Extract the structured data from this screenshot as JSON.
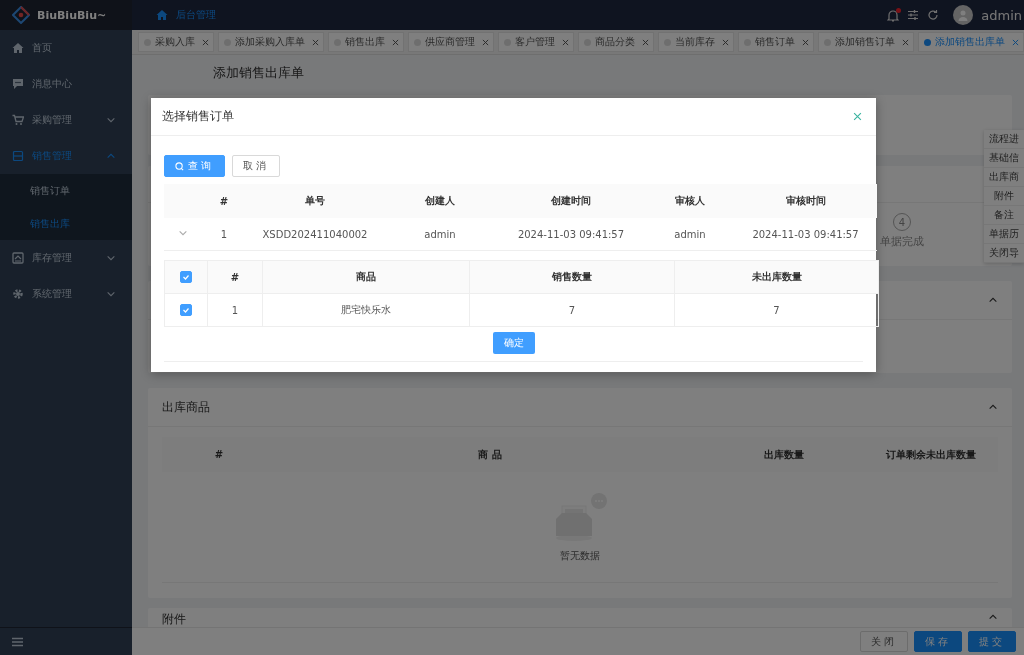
{
  "app": {
    "logo": "BiuBiuBiu~"
  },
  "sidebar": {
    "items": [
      {
        "kind": "link",
        "label": "首页",
        "selected": false
      },
      {
        "kind": "link",
        "label": "消息中心",
        "selected": false
      },
      {
        "kind": "group",
        "label": "采购管理",
        "selected": false,
        "expanded": false
      },
      {
        "kind": "group",
        "label": "销售管理",
        "selected": true,
        "expanded": true,
        "children": [
          {
            "label": "销售订单",
            "selected": false
          },
          {
            "label": "销售出库",
            "selected": true
          }
        ]
      },
      {
        "kind": "group",
        "label": "库存管理",
        "selected": false,
        "expanded": false
      },
      {
        "kind": "group",
        "label": "系统管理",
        "selected": false,
        "expanded": false
      }
    ]
  },
  "header": {
    "breadcrumb": "后台管理",
    "notification": true,
    "user": "admin"
  },
  "tabs": [
    {
      "label": "采购入库",
      "selected": false
    },
    {
      "label": "添加采购入库单",
      "selected": false
    },
    {
      "label": "销售出库",
      "selected": false
    },
    {
      "label": "供应商管理",
      "selected": false
    },
    {
      "label": "客户管理",
      "selected": false
    },
    {
      "label": "商品分类",
      "selected": false
    },
    {
      "label": "当前库存",
      "selected": false
    },
    {
      "label": "销售订单",
      "selected": false
    },
    {
      "label": "添加销售订单",
      "selected": false
    },
    {
      "label": "添加销售出库单",
      "selected": true
    }
  ],
  "page": {
    "title": "添加销售出库单"
  },
  "steps": [
    {
      "number": "4",
      "label": "单据完成"
    }
  ],
  "anchor_nav": [
    "流程进",
    "基础信",
    "出库商",
    "附件",
    "备注",
    "单据历",
    "关闭导"
  ],
  "goods_section": {
    "title": "出库商品",
    "columns": [
      "#",
      "商 品",
      "出库数量",
      "订单剩余未出库数量"
    ],
    "empty_text": "暂无数据"
  },
  "attachment_section": {
    "title": "附件"
  },
  "footer_buttons": [
    {
      "label": "关闭",
      "kind": "default"
    },
    {
      "label": "保存",
      "kind": "primary"
    },
    {
      "label": "提交",
      "kind": "primary"
    }
  ],
  "dialog": {
    "title": "选择销售订单",
    "buttons": [
      {
        "label": "查询",
        "kind": "primary"
      },
      {
        "label": "取消",
        "kind": "default"
      }
    ],
    "table": {
      "columns": [
        "#",
        "单号",
        "创建人",
        "创建时间",
        "审核人",
        "审核时间"
      ],
      "rows": [
        {
          "expanded": true,
          "cells": [
            "1",
            "XSDD202411040002",
            "admin",
            "2024-11-03 09:41:57",
            "admin",
            "2024-11-03 09:41:57"
          ],
          "detail": {
            "all_checked": true,
            "columns": [
              "#",
              "商品",
              "销售数量",
              "未出库数量"
            ],
            "rows": [
              {
                "checked": true,
                "cells": [
                  "1",
                  "肥宅快乐水",
                  "7",
                  "7"
                ]
              }
            ]
          }
        }
      ]
    },
    "confirm": "确定"
  }
}
